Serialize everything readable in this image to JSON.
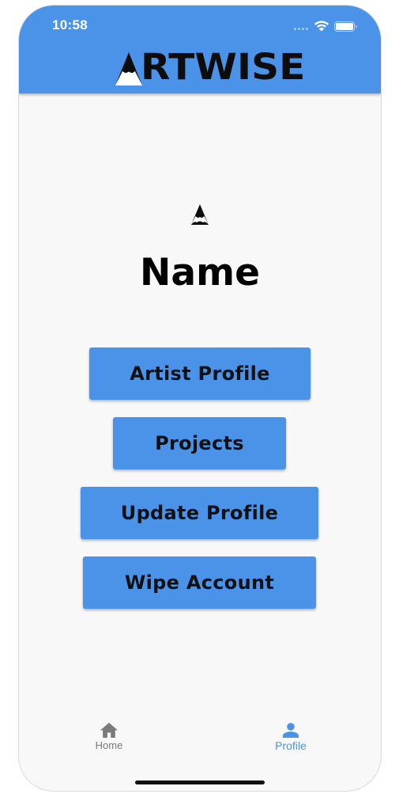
{
  "status_bar": {
    "time": "10:58",
    "wifi_icon": "wifi-icon",
    "battery_icon": "battery-icon"
  },
  "app_bar": {
    "logo_text": "RTWISE",
    "logo_mark_icon": "mountain-a-icon",
    "color": "#4a93e8"
  },
  "profile": {
    "avatar_icon": "mountain-a-icon",
    "name": "Name"
  },
  "actions": {
    "artist_profile": "Artist Profile",
    "projects": "Projects",
    "update_profile": "Update Profile",
    "wipe_account": "Wipe Account"
  },
  "bottom_nav": {
    "items": [
      {
        "label": "Home",
        "icon": "home-icon",
        "active": false
      },
      {
        "label": "Profile",
        "icon": "person-icon",
        "active": true
      }
    ],
    "active_color": "#4a93e8",
    "inactive_color": "#7a7a7a"
  }
}
